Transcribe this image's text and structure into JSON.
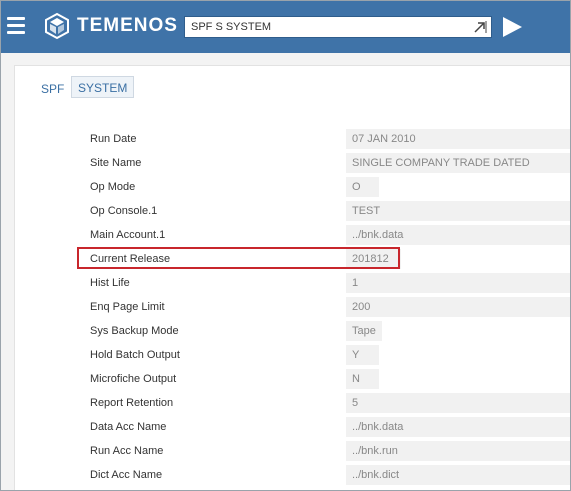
{
  "header": {
    "brand": "TEMENOS",
    "command_value": "SPF S SYSTEM"
  },
  "breadcrumb": {
    "app": "SPF",
    "record": "SYSTEM"
  },
  "fields": [
    {
      "label": "Run Date",
      "value": "07 JAN 2010"
    },
    {
      "label": "Site Name",
      "value": "SINGLE COMPANY TRADE DATED"
    },
    {
      "label": "Op Mode",
      "value": "O"
    },
    {
      "label": "Op Console.1",
      "value": "TEST"
    },
    {
      "label": "Main Account.1",
      "value": "../bnk.data"
    },
    {
      "label": "Current Release",
      "value": "201812"
    },
    {
      "label": "Hist Life",
      "value": "1"
    },
    {
      "label": "Enq Page Limit",
      "value": "200"
    },
    {
      "label": "Sys Backup Mode",
      "value": "Tape"
    },
    {
      "label": "Hold Batch Output",
      "value": "Y"
    },
    {
      "label": "Microfiche Output",
      "value": "N"
    },
    {
      "label": "Report Retention",
      "value": "5"
    },
    {
      "label": "Data Acc Name",
      "value": "../bnk.data"
    },
    {
      "label": "Run Acc Name",
      "value": "../bnk.run"
    },
    {
      "label": "Dict Acc Name",
      "value": "../bnk.dict"
    }
  ],
  "icons": {
    "menu": "hamburger-menu-icon",
    "logo": "temenos-globe-logo",
    "expand": "expand-arrow-icon",
    "go": "play-triangle-icon"
  },
  "colors": {
    "header_bg": "#3f73a8",
    "highlight": "#c8262c",
    "link": "#3a6fa3"
  }
}
